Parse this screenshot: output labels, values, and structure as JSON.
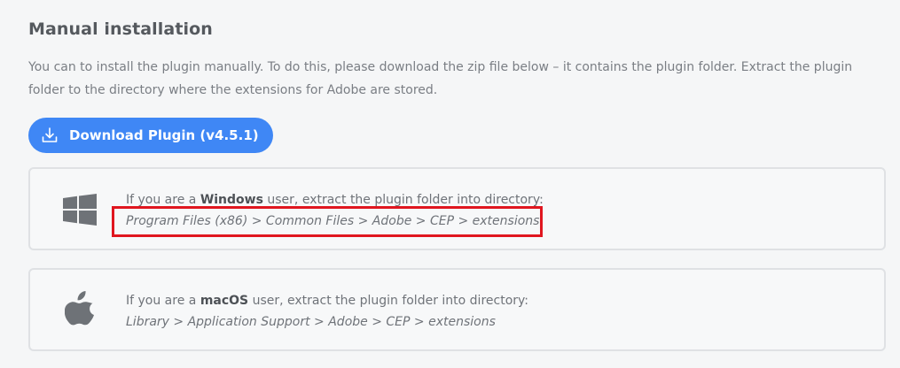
{
  "section": {
    "title": "Manual installation",
    "intro": "You can to install the plugin manually. To do this, please download the zip file below – it contains the plugin folder. Extract the plugin folder to the directory where the extensions for Adobe are stored."
  },
  "download": {
    "label": "Download Plugin (v4.5.1)",
    "icon": "download-icon",
    "color": "#3f87f5"
  },
  "windows": {
    "icon": "windows-logo-icon",
    "prefix": "If you are a ",
    "os": "Windows",
    "suffix": " user, extract the plugin folder into directory:",
    "path": "Program Files (x86) > Common Files > Adobe > CEP > extensions"
  },
  "mac": {
    "icon": "apple-logo-icon",
    "prefix": "If you are a ",
    "os": "macOS",
    "suffix": " user, extract the plugin folder into directory:",
    "path": "Library > Application Support > Adobe > CEP > extensions"
  },
  "highlight_color": "#e0161f"
}
